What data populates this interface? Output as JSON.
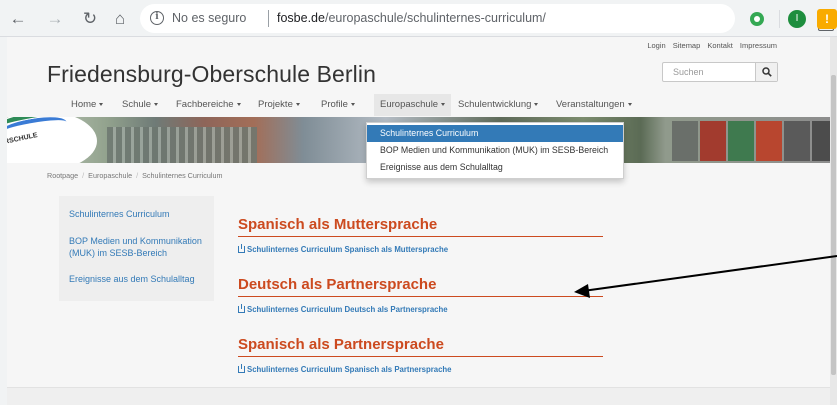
{
  "browser": {
    "security_text": "No es seguro",
    "url_domain": "fosbe.de",
    "url_path": "/europaschule/schulinternes-curriculum/",
    "profile_letter": "I",
    "update_label": "!"
  },
  "site": {
    "title": "Friedensburg-Oberschule Berlin",
    "logo_text": "OBERSCHULE",
    "top_links": [
      "Login",
      "Sitemap",
      "Kontakt",
      "Impressum"
    ],
    "search_placeholder": "Suchen"
  },
  "nav": {
    "items": [
      {
        "label": "Home"
      },
      {
        "label": "Schule"
      },
      {
        "label": "Fachbereiche"
      },
      {
        "label": "Projekte"
      },
      {
        "label": "Profile"
      },
      {
        "label": "Europaschule"
      },
      {
        "label": "Schulentwicklung"
      },
      {
        "label": "Veranstaltungen"
      }
    ],
    "active": "Europaschule",
    "dropdown": [
      "Schulinternes Curriculum",
      "BOP Medien und Kommunikation (MUK) im SESB-Bereich",
      "Ereignisse aus dem Schulalltag"
    ]
  },
  "breadcrumb": [
    "Rootpage",
    "Europaschule",
    "Schulinternes Curriculum"
  ],
  "sidebar": {
    "items": [
      "Schulinternes Curriculum",
      "BOP Medien und Kommunikation (MUK) im SESB-Bereich",
      "Ereignisse aus dem Schulalltag"
    ]
  },
  "sections": [
    {
      "heading": "Spanisch als Muttersprache",
      "link": "Schulinternes Curriculum Spanisch als Muttersprache"
    },
    {
      "heading": "Deutsch als Partnersprache",
      "link": "Schulinternes Curriculum Deutsch als Partnersprache"
    },
    {
      "heading": "Spanisch als Partnersprache",
      "link": "Schulinternes Curriculum Spanisch als Partnersprache"
    }
  ],
  "colors": {
    "heading": "#cc4a1f",
    "link": "#337ab7",
    "dropdown_selected": "#337ab7"
  }
}
